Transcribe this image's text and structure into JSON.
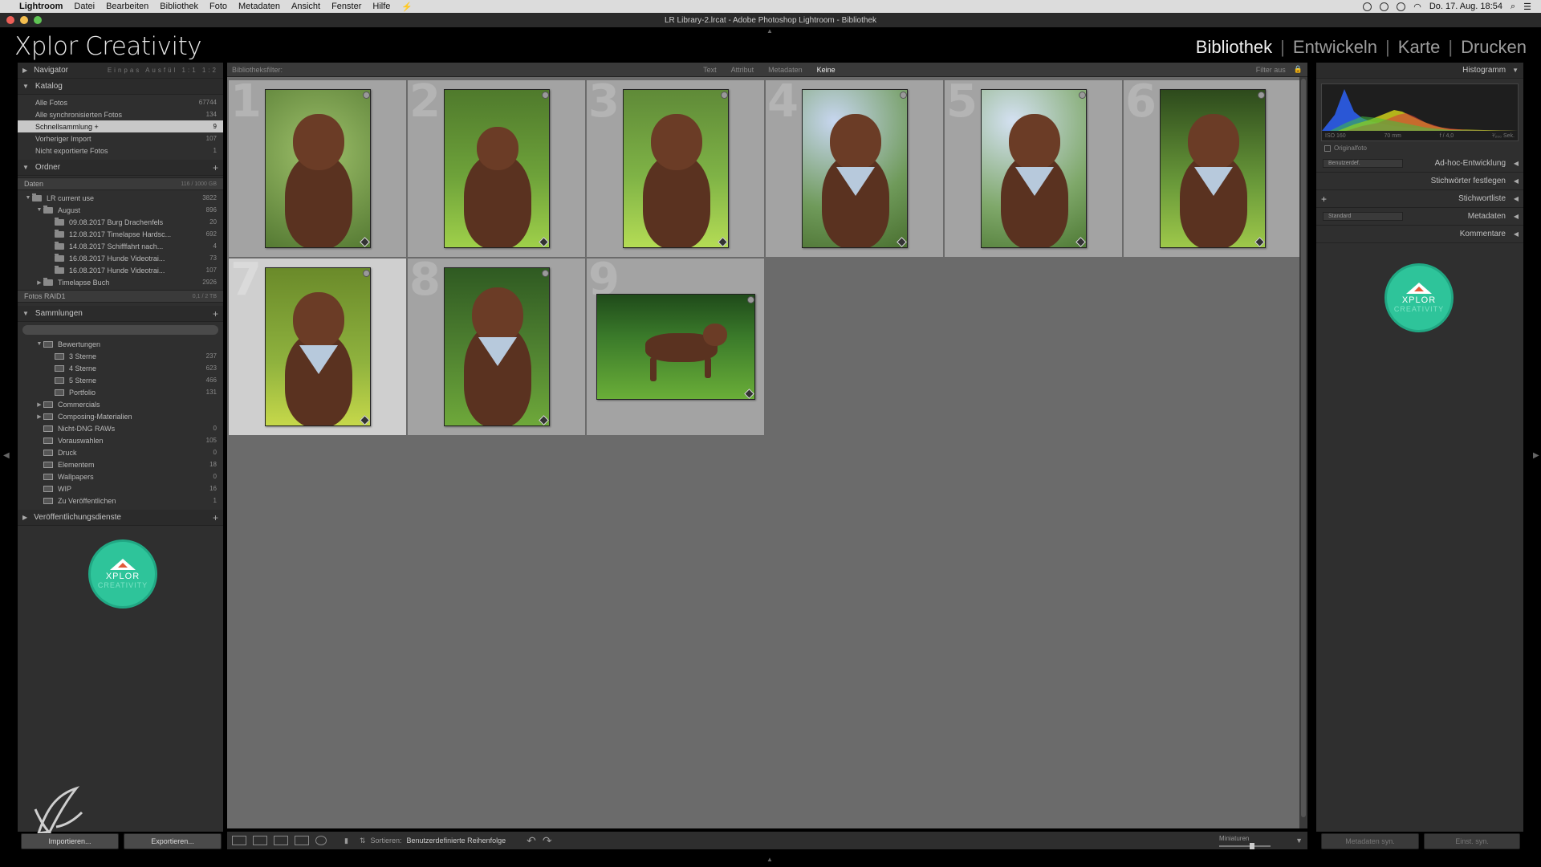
{
  "menubar": {
    "app": "Lightroom",
    "items": [
      "Datei",
      "Bearbeiten",
      "Bibliothek",
      "Foto",
      "Metadaten",
      "Ansicht",
      "Fenster",
      "Hilfe"
    ],
    "clock": "Do. 17. Aug. 18:54"
  },
  "window": {
    "title": "LR Library-2.lrcat - Adobe Photoshop Lightroom - Bibliothek"
  },
  "identity": {
    "brand": "Xplor Creativity"
  },
  "modules": {
    "items": [
      "Bibliothek",
      "Entwickeln",
      "Karte",
      "Drucken"
    ],
    "active": "Bibliothek"
  },
  "left": {
    "navigator": {
      "title": "Navigator",
      "zoom_options": "Einpas  Ausfül  1:1  1:2"
    },
    "katalog": {
      "title": "Katalog",
      "items": [
        {
          "label": "Alle Fotos",
          "count": "67744"
        },
        {
          "label": "Alle synchronisierten Fotos",
          "count": "134"
        },
        {
          "label": "Schnellsammlung +",
          "count": "9"
        },
        {
          "label": "Vorheriger Import",
          "count": "107"
        },
        {
          "label": "Nicht exportierte Fotos",
          "count": "1"
        }
      ]
    },
    "ordner": {
      "title": "Ordner",
      "volume1": {
        "label": "Daten",
        "info": "116 / 1000 GB"
      },
      "items": [
        {
          "label": "LR current use",
          "count": "3822"
        },
        {
          "label": "August",
          "count": "896"
        },
        {
          "label": "09.08.2017 Burg Drachenfels",
          "count": "20"
        },
        {
          "label": "12.08.2017 Timelapse Hardsc...",
          "count": "692"
        },
        {
          "label": "14.08.2017 Schifffahrt nach...",
          "count": "4"
        },
        {
          "label": "16.08.2017 Hunde Videotrai...",
          "count": "73"
        },
        {
          "label": "16.08.2017 Hunde Videotrai...",
          "count": "107"
        },
        {
          "label": "Timelapse Buch",
          "count": "2926"
        }
      ],
      "volume2": {
        "label": "Fotos RAID1",
        "info": "0,1 / 2 TB"
      }
    },
    "sammlungen": {
      "title": "Sammlungen",
      "items": [
        {
          "label": "Bewertungen",
          "count": ""
        },
        {
          "label": "3 Sterne",
          "count": "237"
        },
        {
          "label": "4 Sterne",
          "count": "623"
        },
        {
          "label": "5 Sterne",
          "count": "466"
        },
        {
          "label": "Portfolio",
          "count": "131"
        },
        {
          "label": "Commercials",
          "count": ""
        },
        {
          "label": "Composing-Materialien",
          "count": ""
        },
        {
          "label": "Nicht-DNG RAWs",
          "count": "0"
        },
        {
          "label": "Vorauswahlen",
          "count": "105"
        },
        {
          "label": "Druck",
          "count": "0"
        },
        {
          "label": "Elementem",
          "count": "18"
        },
        {
          "label": "Wallpapers",
          "count": "0"
        },
        {
          "label": "WIP",
          "count": "16"
        },
        {
          "label": "Zu Veröffentlichen",
          "count": "1"
        }
      ]
    },
    "publish": {
      "title": "Veröffentlichungsdienste"
    },
    "logo": {
      "line1": "XPLOR",
      "line2": "CREATIVITY"
    },
    "import_label": "Importieren...",
    "export_label": "Exportieren..."
  },
  "filterbar": {
    "label": "Bibliotheksfilter:",
    "options": [
      "Text",
      "Attribut",
      "Metadaten",
      "Keine"
    ],
    "active": "Keine",
    "filter_off": "Filter aus"
  },
  "grid": {
    "cells": [
      {
        "num": "1",
        "selected": false
      },
      {
        "num": "2",
        "selected": false
      },
      {
        "num": "3",
        "selected": false
      },
      {
        "num": "4",
        "selected": false
      },
      {
        "num": "5",
        "selected": false
      },
      {
        "num": "6",
        "selected": false
      },
      {
        "num": "7",
        "selected": true
      },
      {
        "num": "8",
        "selected": false
      },
      {
        "num": "9",
        "selected": false
      }
    ]
  },
  "toolbar": {
    "sort_label": "Sortieren:",
    "sort_value": "Benutzerdefinierte Reihenfolge",
    "thumbs_label": "Miniaturen"
  },
  "right": {
    "histogram": {
      "title": "Histogramm",
      "iso": "ISO 160",
      "focal": "70 mm",
      "aperture": "f / 4,0",
      "shutter": "¹⁄₂₀₀ Sek.",
      "original": "Originalfoto"
    },
    "quick_develop": {
      "title": "Ad-hoc-Entwicklung",
      "preset": "Benutzerdef."
    },
    "keywording": {
      "title": "Stichwörter festlegen"
    },
    "keyword_list": {
      "title": "Stichwortliste"
    },
    "metadata": {
      "title": "Metadaten",
      "preset": "Standard"
    },
    "comments": {
      "title": "Kommentare"
    },
    "logo": {
      "line1": "XPLOR",
      "line2": "CREATIVITY"
    },
    "sync_meta": "Metadaten syn.",
    "sync_settings": "Einst. syn."
  }
}
